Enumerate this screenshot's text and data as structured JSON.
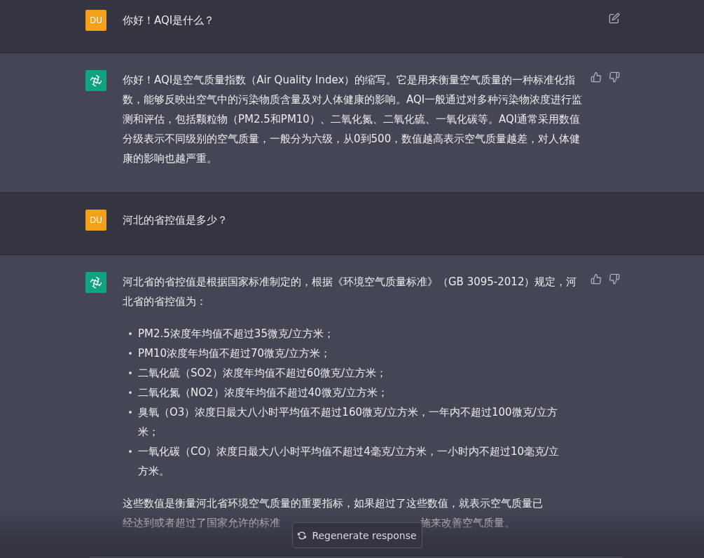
{
  "messages": [
    {
      "kind": "user",
      "avatar": "DU",
      "text": "你好！AQI是什么？",
      "edit_icon": true
    },
    {
      "kind": "assistant",
      "paragraphs": [
        "你好！AQI是空气质量指数（Air Quality Index）的缩写。它是用来衡量空气质量的一种标准化指数，能够反映出空气中的污染物质含量及对人体健康的影响。AQI一般通过对多种污染物浓度进行监测和评估，包括颗粒物（PM2.5和PM10）、二氧化氮、二氧化硫、一氧化碳等。AQI通常采用数值分级表示不同级别的空气质量，一般分为六级，从0到500，数值越高表示空气质量越差，对人体健康的影响也越严重。"
      ]
    },
    {
      "kind": "user",
      "avatar": "DU",
      "text": "河北的省控值是多少？",
      "edit_icon": false
    },
    {
      "kind": "assistant",
      "paragraphs": [
        "河北省的省控值是根据国家标准制定的，根据《环境空气质量标准》（GB 3095-2012）规定，河北省的省控值为："
      ],
      "bullets": [
        "PM2.5浓度年均值不超过35微克/立方米；",
        "PM10浓度年均值不超过70微克/立方米；",
        "二氧化硫（SO2）浓度年均值不超过60微克/立方米；",
        "二氧化氮（NO2）浓度年均值不超过40微克/立方米；",
        "臭氧（O3）浓度日最大八小时平均值不超过160微克/立方米，一年内不超过100微克/立方米；",
        "一氧化碳（CO）浓度日最大八小时平均值不超过4毫克/立方米，一小时内不超过10毫克/立方米。"
      ],
      "closing_line": "这些数值是衡量河北省环境空气质量的重要指标，如果超过了这些数值，就表示空气质量已",
      "closing_visible_parts": [
        "经达到或者超过了国家允许的标准",
        "施来改善空气质量。"
      ]
    }
  ],
  "regenerate_button": "Regenerate response"
}
